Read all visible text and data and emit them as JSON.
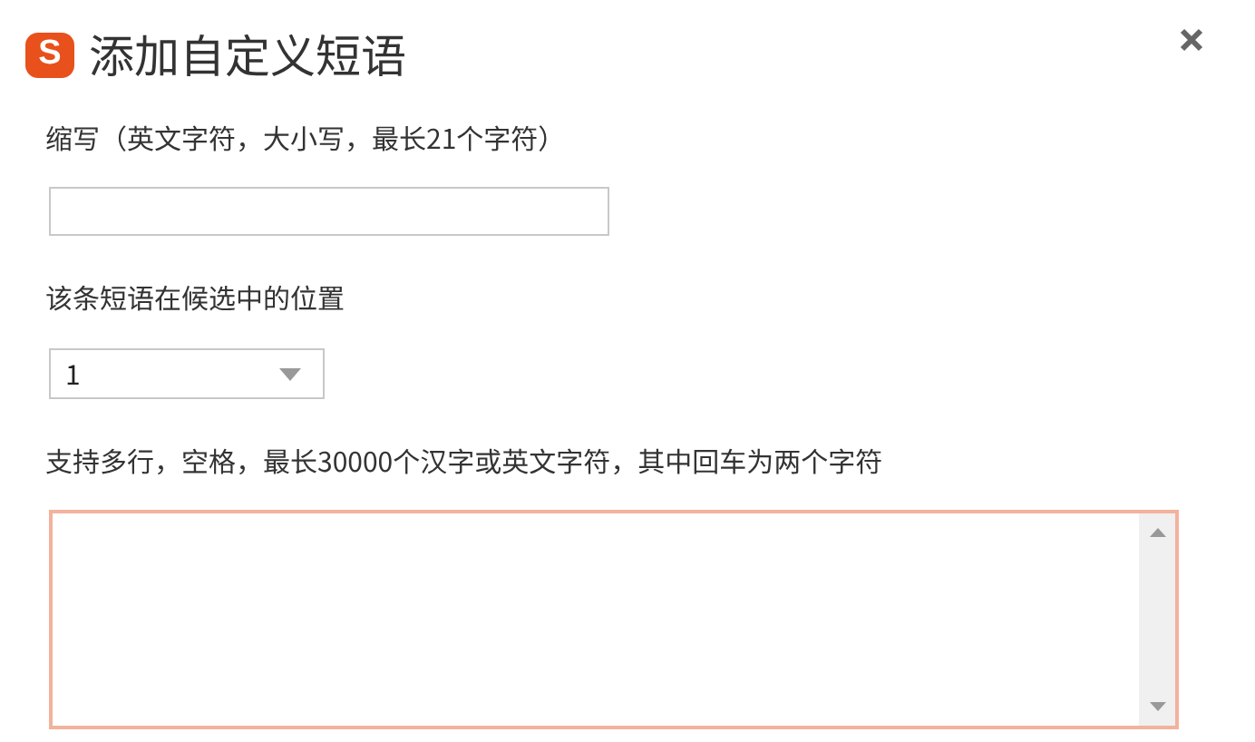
{
  "window": {
    "title": "添加自定义短语",
    "logo": "S"
  },
  "abbreviation": {
    "label": "缩写（英文字符，大小写，最长21个字符）"
  },
  "position": {
    "label": "该条短语在候选中的位置",
    "value": "1"
  },
  "phrase": {
    "label": "支持多行，空格，最长30000个汉字或英文字符，其中回车为两个字符",
    "focused": true
  }
}
